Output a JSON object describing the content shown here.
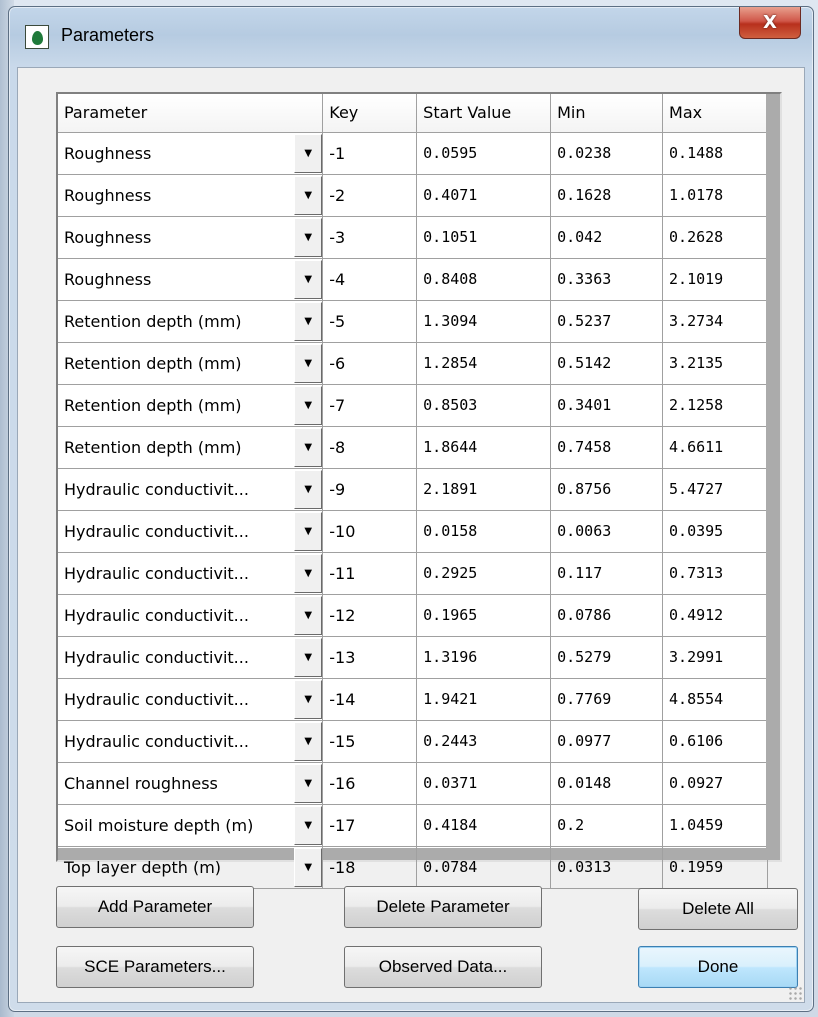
{
  "window": {
    "title": "Parameters",
    "close_glyph": "X"
  },
  "table": {
    "headers": [
      "Parameter",
      "Key",
      "Start Value",
      "Min",
      "Max"
    ],
    "rows": [
      {
        "parameter": "Roughness",
        "key": "-1",
        "start": "0.0595",
        "min": "0.0238",
        "max": "0.1488"
      },
      {
        "parameter": "Roughness",
        "key": "-2",
        "start": "0.4071",
        "min": "0.1628",
        "max": "1.0178"
      },
      {
        "parameter": "Roughness",
        "key": "-3",
        "start": "0.1051",
        "min": "0.042",
        "max": "0.2628"
      },
      {
        "parameter": "Roughness",
        "key": "-4",
        "start": "0.8408",
        "min": "0.3363",
        "max": "2.1019"
      },
      {
        "parameter": "Retention depth (mm)",
        "key": "-5",
        "start": "1.3094",
        "min": "0.5237",
        "max": "3.2734"
      },
      {
        "parameter": "Retention depth (mm)",
        "key": "-6",
        "start": "1.2854",
        "min": "0.5142",
        "max": "3.2135"
      },
      {
        "parameter": "Retention depth (mm)",
        "key": "-7",
        "start": "0.8503",
        "min": "0.3401",
        "max": "2.1258"
      },
      {
        "parameter": "Retention depth (mm)",
        "key": "-8",
        "start": "1.8644",
        "min": "0.7458",
        "max": "4.6611"
      },
      {
        "parameter": "Hydraulic conductivit...",
        "key": "-9",
        "start": "2.1891",
        "min": "0.8756",
        "max": "5.4727"
      },
      {
        "parameter": "Hydraulic conductivit...",
        "key": "-10",
        "start": "0.0158",
        "min": "0.0063",
        "max": "0.0395"
      },
      {
        "parameter": "Hydraulic conductivit...",
        "key": "-11",
        "start": "0.2925",
        "min": "0.117",
        "max": "0.7313"
      },
      {
        "parameter": "Hydraulic conductivit...",
        "key": "-12",
        "start": "0.1965",
        "min": "0.0786",
        "max": "0.4912"
      },
      {
        "parameter": "Hydraulic conductivit...",
        "key": "-13",
        "start": "1.3196",
        "min": "0.5279",
        "max": "3.2991"
      },
      {
        "parameter": "Hydraulic conductivit...",
        "key": "-14",
        "start": "1.9421",
        "min": "0.7769",
        "max": "4.8554"
      },
      {
        "parameter": "Hydraulic conductivit...",
        "key": "-15",
        "start": "0.2443",
        "min": "0.0977",
        "max": "0.6106"
      },
      {
        "parameter": "Channel roughness",
        "key": "-16",
        "start": "0.0371",
        "min": "0.0148",
        "max": "0.0927"
      },
      {
        "parameter": "Soil moisture depth (m)",
        "key": "-17",
        "start": "0.4184",
        "min": "0.2",
        "max": "1.0459"
      },
      {
        "parameter": "Top layer depth (m)",
        "key": "-18",
        "start": "0.0784",
        "min": "0.0313",
        "max": "0.1959"
      }
    ]
  },
  "buttons": {
    "add_parameter": "Add Parameter",
    "delete_parameter": "Delete Parameter",
    "delete_all": "Delete All",
    "sce_parameters": "SCE Parameters...",
    "observed_data": "Observed Data...",
    "done": "Done"
  },
  "colors": {
    "close_button": "#c9452f",
    "default_button_border": "#3c7fb1",
    "app_icon": "#1f7a3a"
  },
  "icons": {
    "app": "water-drop-icon",
    "close": "close-icon",
    "dropdown": "chevron-down-icon"
  }
}
